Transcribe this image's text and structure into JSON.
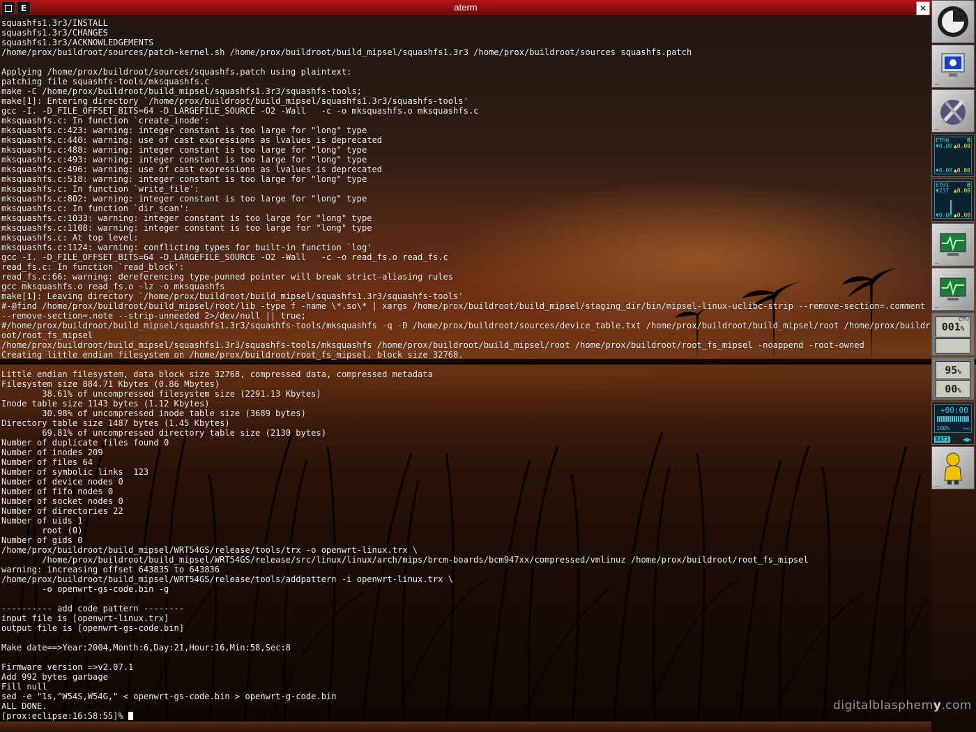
{
  "window": {
    "title": "aterm",
    "left_button_label": "",
    "menu_button_label": "E",
    "close_label": "✕"
  },
  "terminal": {
    "lines": [
      "squashfs1.3r3/INSTALL",
      "squashfs1.3r3/CHANGES",
      "squashfs1.3r3/ACKNOWLEDGEMENTS",
      "/home/prox/buildroot/sources/patch-kernel.sh /home/prox/buildroot/build_mipsel/squashfs1.3r3 /home/prox/buildroot/sources squashfs.patch",
      "",
      "Applying /home/prox/buildroot/sources/squashfs.patch using plaintext:",
      "patching file squashfs-tools/mksquashfs.c",
      "make -C /home/prox/buildroot/build_mipsel/squashfs1.3r3/squashfs-tools;",
      "make[1]: Entering directory `/home/prox/buildroot/build_mipsel/squashfs1.3r3/squashfs-tools'",
      "gcc -I. -D_FILE_OFFSET_BITS=64 -D_LARGEFILE_SOURCE -O2 -Wall   -c -o mksquashfs.o mksquashfs.c",
      "mksquashfs.c: In function `create_inode':",
      "mksquashfs.c:423: warning: integer constant is too large for \"long\" type",
      "mksquashfs.c:440: warning: use of cast expressions as lvalues is deprecated",
      "mksquashfs.c:488: warning: integer constant is too large for \"long\" type",
      "mksquashfs.c:493: warning: integer constant is too large for \"long\" type",
      "mksquashfs.c:496: warning: use of cast expressions as lvalues is deprecated",
      "mksquashfs.c:518: warning: integer constant is too large for \"long\" type",
      "mksquashfs.c: In function `write_file':",
      "mksquashfs.c:802: warning: integer constant is too large for \"long\" type",
      "mksquashfs.c: In function `dir_scan':",
      "mksquashfs.c:1033: warning: integer constant is too large for \"long\" type",
      "mksquashfs.c:1108: warning: integer constant is too large for \"long\" type",
      "mksquashfs.c: At top level:",
      "mksquashfs.c:1124: warning: conflicting types for built-in function `log'",
      "gcc -I. -D_FILE_OFFSET_BITS=64 -D_LARGEFILE_SOURCE -O2 -Wall   -c -o read_fs.o read_fs.c",
      "read_fs.c: In function `read_block':",
      "read_fs.c:66: warning: dereferencing type-punned pointer will break strict-aliasing rules",
      "gcc mksquashfs.o read_fs.o -lz -o mksquashfs",
      "make[1]: Leaving directory `/home/prox/buildroot/build_mipsel/squashfs1.3r3/squashfs-tools'",
      "#-@find /home/prox/buildroot/build_mipsel/root/lib -type f -name \\*.so\\* | xargs /home/prox/buildroot/build_mipsel/staging_dir/bin/mipsel-linux-uclibc-strip --remove-section=.comment --remove-section=.note --strip-unneeded 2>/dev/null || true;",
      "#/home/prox/buildroot/build_mipsel/squashfs1.3r3/squashfs-tools/mksquashfs -q -D /home/prox/buildroot/sources/device_table.txt /home/prox/buildroot/build_mipsel/root /home/prox/buildroot/root_fs_mipsel",
      "/home/prox/buildroot/build_mipsel/squashfs1.3r3/squashfs-tools/mksquashfs /home/prox/buildroot/build_mipsel/root /home/prox/buildroot/root_fs_mipsel -noappend -root-owned",
      "Creating little endian filesystem on /home/prox/buildroot/root_fs_mipsel, block size 32768.",
      "",
      "Little endian filesystem, data block size 32768, compressed data, compressed metadata",
      "Filesystem size 884.71 Kbytes (0.86 Mbytes)",
      "        38.61% of uncompressed filesystem size (2291.13 Kbytes)",
      "Inode table size 1143 bytes (1.12 Kbytes)",
      "        30.98% of uncompressed inode table size (3689 bytes)",
      "Directory table size 1487 bytes (1.45 Kbytes)",
      "        69.81% of uncompressed directory table size (2130 bytes)",
      "Number of duplicate files found 0",
      "Number of inodes 209",
      "Number of files 64",
      "Number of symbolic links  123",
      "Number of device nodes 0",
      "Number of fifo nodes 0",
      "Number of socket nodes 0",
      "Number of directories 22",
      "Number of uids 1",
      "        root (0)",
      "Number of gids 0",
      "/home/prox/buildroot/build_mipsel/WRT54GS/release/tools/trx -o openwrt-linux.trx \\",
      "        /home/prox/buildroot/build_mipsel/WRT54GS/release/src/linux/linux/arch/mips/brcm-boards/bcm947xx/compressed/vmlinuz /home/prox/buildroot/root_fs_mipsel",
      "warning: increasing offset 643835 to 643836",
      "/home/prox/buildroot/build_mipsel/WRT54GS/release/tools/addpattern -i openwrt-linux.trx \\",
      "        -o openwrt-gs-code.bin -g",
      "",
      "---------- add code pattern --------",
      "input file is [openwrt-linux.trx]",
      "output file is [openwrt-gs-code.bin]",
      "",
      "Make date==>Year:2004,Month:6,Day:21,Hour:16,Min:58,Sec:8",
      "",
      "Firmware version =>v2.07.1",
      "Add 992 bytes garbage",
      "Fill null",
      "sed -e \"1s,^W54S,W54G,\" < openwrt-gs-code.bin > openwrt-g-code.bin",
      "ALL DONE."
    ],
    "prompt": "[prox:eclipse:16:58:55]% "
  },
  "watermark": {
    "prefix": "digitalblasphem",
    "bold": "y",
    "suffix": ".com"
  },
  "dock": {
    "net1": {
      "label": "ETH0",
      "rx": "▼0.00",
      "tx": "▲0.00",
      "rx2": "▼0.00",
      "tx2": "▲0.00",
      "unit": "B"
    },
    "net2": {
      "label": "ETH1",
      "rx": "▼237",
      "tx": "▲0.00",
      "rx2": "▼0.00",
      "tx2": "▲0.00",
      "unit": "B"
    },
    "cpu": {
      "label": "CPU",
      "value": "001",
      "unit": "%"
    },
    "mem": {
      "v1": "95",
      "v2": "00",
      "unit": "%"
    },
    "battery": {
      "time": "+00:00",
      "percent": "100%",
      "slot": "BAT2"
    }
  },
  "colors": {
    "titlebar": "#b31616",
    "terminal_text": "#f0f0f0",
    "dock_lcd": "#39c8e0"
  }
}
